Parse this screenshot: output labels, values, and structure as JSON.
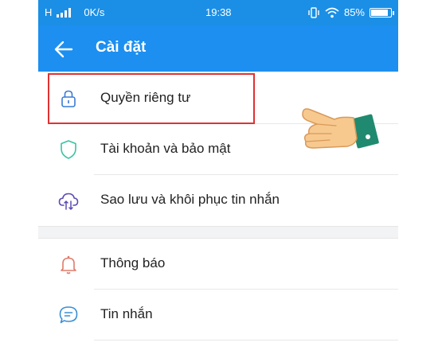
{
  "status_bar": {
    "network": "H",
    "speed": "0K/s",
    "time": "19:38",
    "battery": "85%"
  },
  "header": {
    "title": "Cài đặt",
    "back_icon": "arrow-left-icon"
  },
  "settings": {
    "items": [
      {
        "label": "Quyền riêng tư",
        "icon": "lock-icon",
        "highlighted": true
      },
      {
        "label": "Tài khoản và bảo mật",
        "icon": "shield-icon"
      },
      {
        "label": "Sao lưu và khôi phục tin nhắn",
        "icon": "cloud-sync-icon"
      },
      {
        "label": "Thông báo",
        "icon": "bell-icon"
      },
      {
        "label": "Tin nhắn",
        "icon": "chat-bubble-icon"
      }
    ]
  },
  "colors": {
    "app_bar": "#1c8ff0",
    "highlight": "#e03232",
    "shield": "#39c3a3",
    "bell": "#e07b6a"
  }
}
